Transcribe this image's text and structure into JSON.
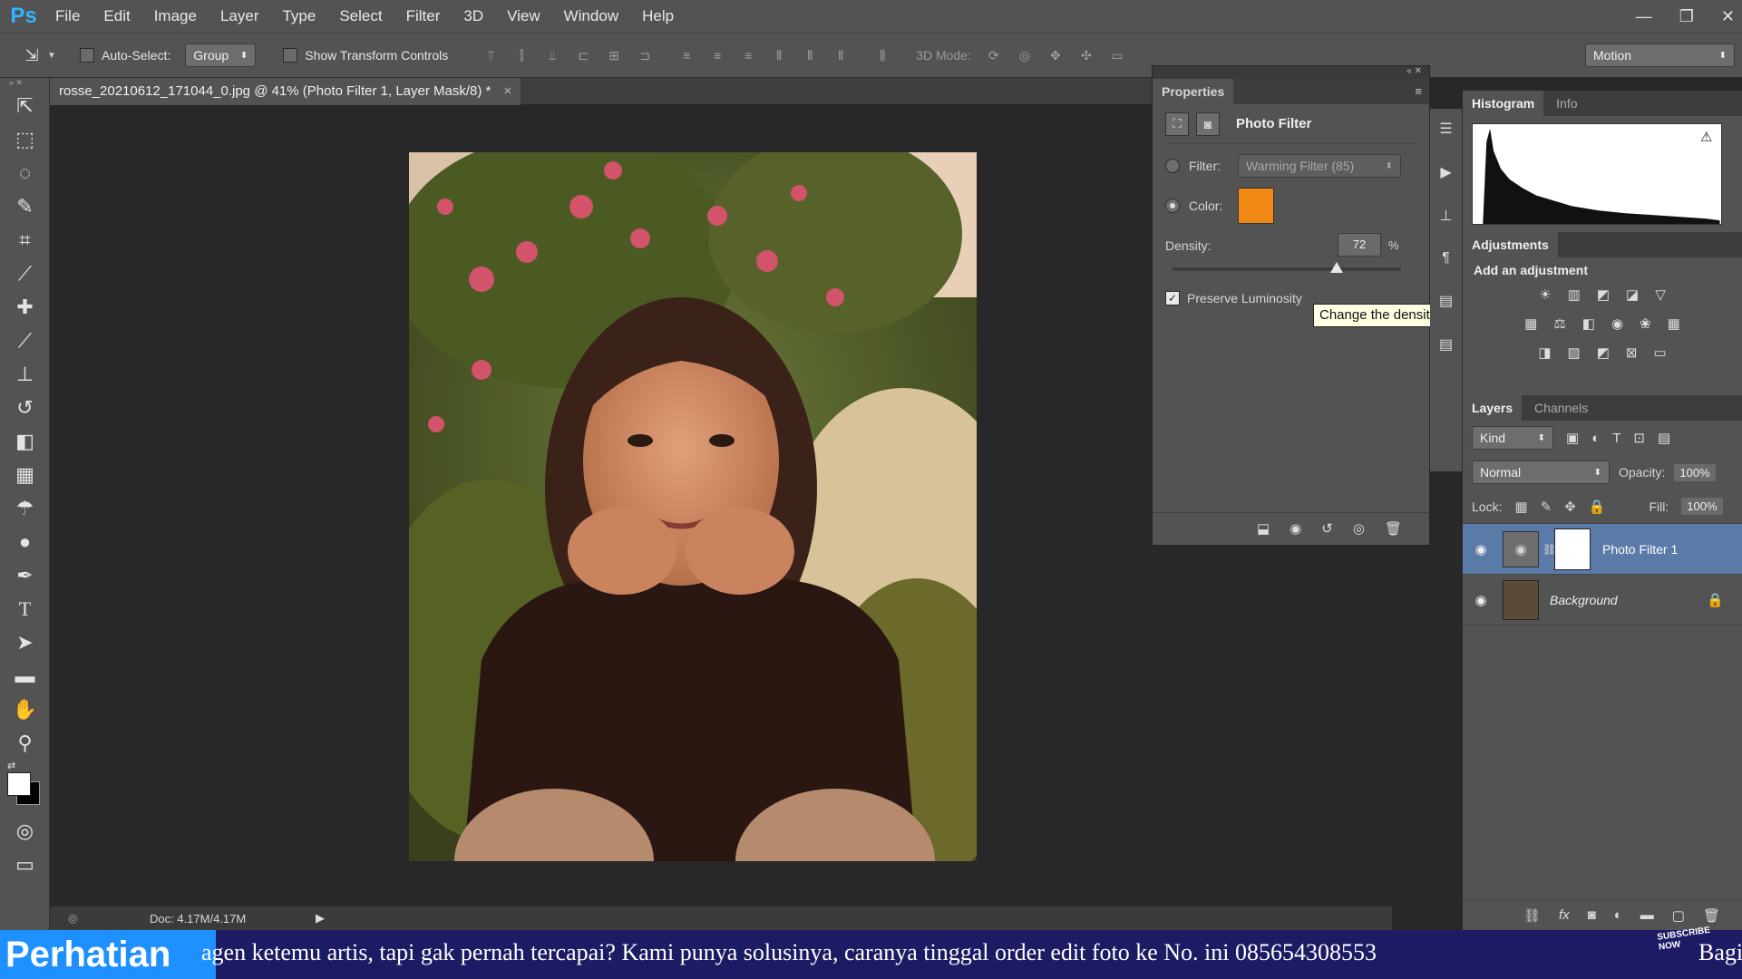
{
  "app": {
    "logo": "Ps"
  },
  "menu": [
    "File",
    "Edit",
    "Image",
    "Layer",
    "Type",
    "Select",
    "Filter",
    "3D",
    "View",
    "Window",
    "Help"
  ],
  "window_controls": {
    "minimize": "—",
    "restore": "❐",
    "close": "✕"
  },
  "options": {
    "auto_select_label": "Auto-Select:",
    "auto_select_value": "Group",
    "show_transform_label": "Show Transform Controls",
    "mode3d_label": "3D Mode:",
    "workspace": "Motion"
  },
  "document": {
    "tab_title": "rosse_20210612_171044_0.jpg @ 41% (Photo Filter 1, Layer Mask/8) *",
    "close": "×",
    "status": "Doc: 4.17M/4.17M"
  },
  "properties": {
    "tab": "Properties",
    "title": "Photo Filter",
    "filter_label": "Filter:",
    "filter_value": "Warming Filter (85)",
    "color_label": "Color:",
    "color_swatch": "#f08a14",
    "density_label": "Density:",
    "density_value": "72",
    "density_unit": "%",
    "density_fraction": 0.72,
    "preserve_label": "Preserve Luminosity",
    "tooltip": "Change the density of the filter effect."
  },
  "histogram": {
    "tab_active": "Histogram",
    "tab_other": "Info"
  },
  "adjustments": {
    "tab": "Adjustments",
    "heading": "Add an adjustment"
  },
  "layers": {
    "tab_active": "Layers",
    "tab_other": "Channels",
    "kind": "Kind",
    "blend_mode": "Normal",
    "opacity_label": "Opacity:",
    "opacity_value": "100%",
    "lock_label": "Lock:",
    "fill_label": "Fill:",
    "fill_value": "100%",
    "items": [
      {
        "name": "Photo Filter 1"
      },
      {
        "name": "Background"
      }
    ]
  },
  "banner": {
    "label": "Perhatian",
    "text": "agen ketemu artis, tapi gak pernah tercapai? Kami punya solusinya, caranya tinggal order edit foto ke No. ini 085654308553",
    "right": "Bagi",
    "subscribe": "SUBSCRIBE NOW"
  },
  "colors": {
    "accent": "#1e90ff",
    "panel": "#535353",
    "banner": "#1c1b64"
  }
}
